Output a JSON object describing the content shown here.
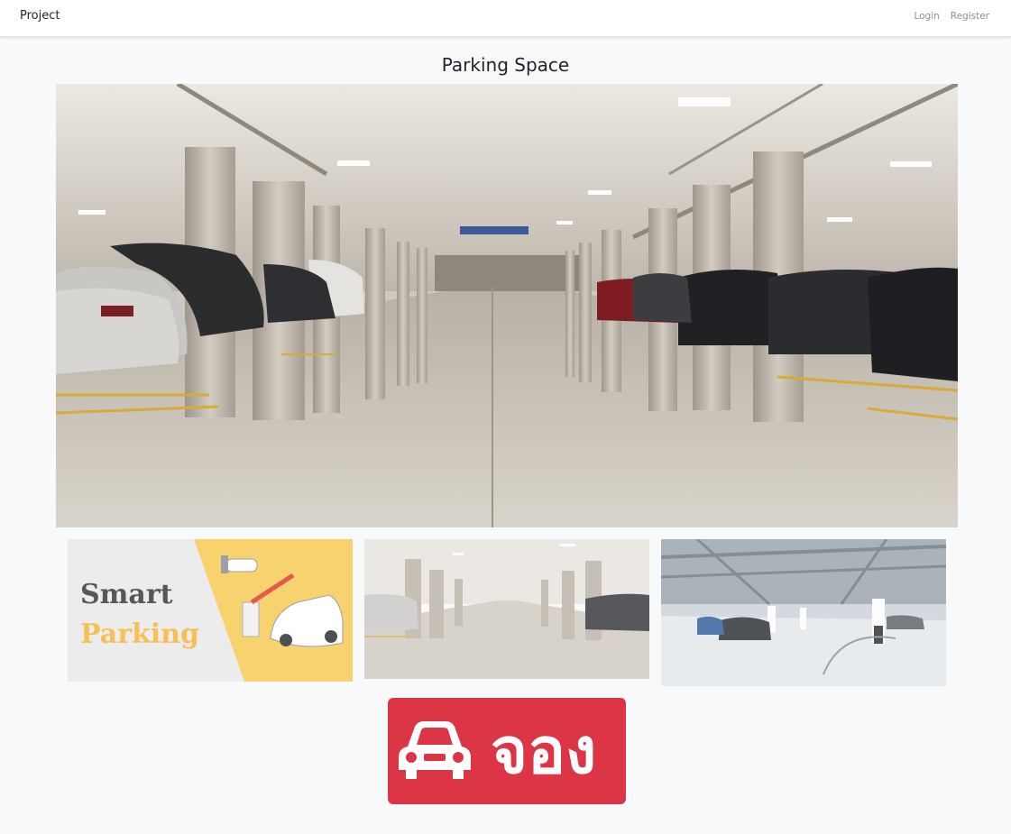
{
  "nav": {
    "brand": "Project",
    "login": "Login",
    "register": "Register"
  },
  "page": {
    "title": "Parking Space"
  },
  "gallery": {
    "hero_icon": "parking-garage-photo",
    "thumbs": [
      {
        "icon": "smart-parking-banner",
        "line1": "Smart",
        "line2": "Parking"
      },
      {
        "icon": "parking-garage-photo"
      },
      {
        "icon": "underground-parking-photo"
      }
    ]
  },
  "booking": {
    "label": "จอง",
    "icon": "car-icon"
  },
  "colors": {
    "accent": "#dc3545",
    "banner_yellow": "#f9d270",
    "background": "#f8f9fa"
  }
}
